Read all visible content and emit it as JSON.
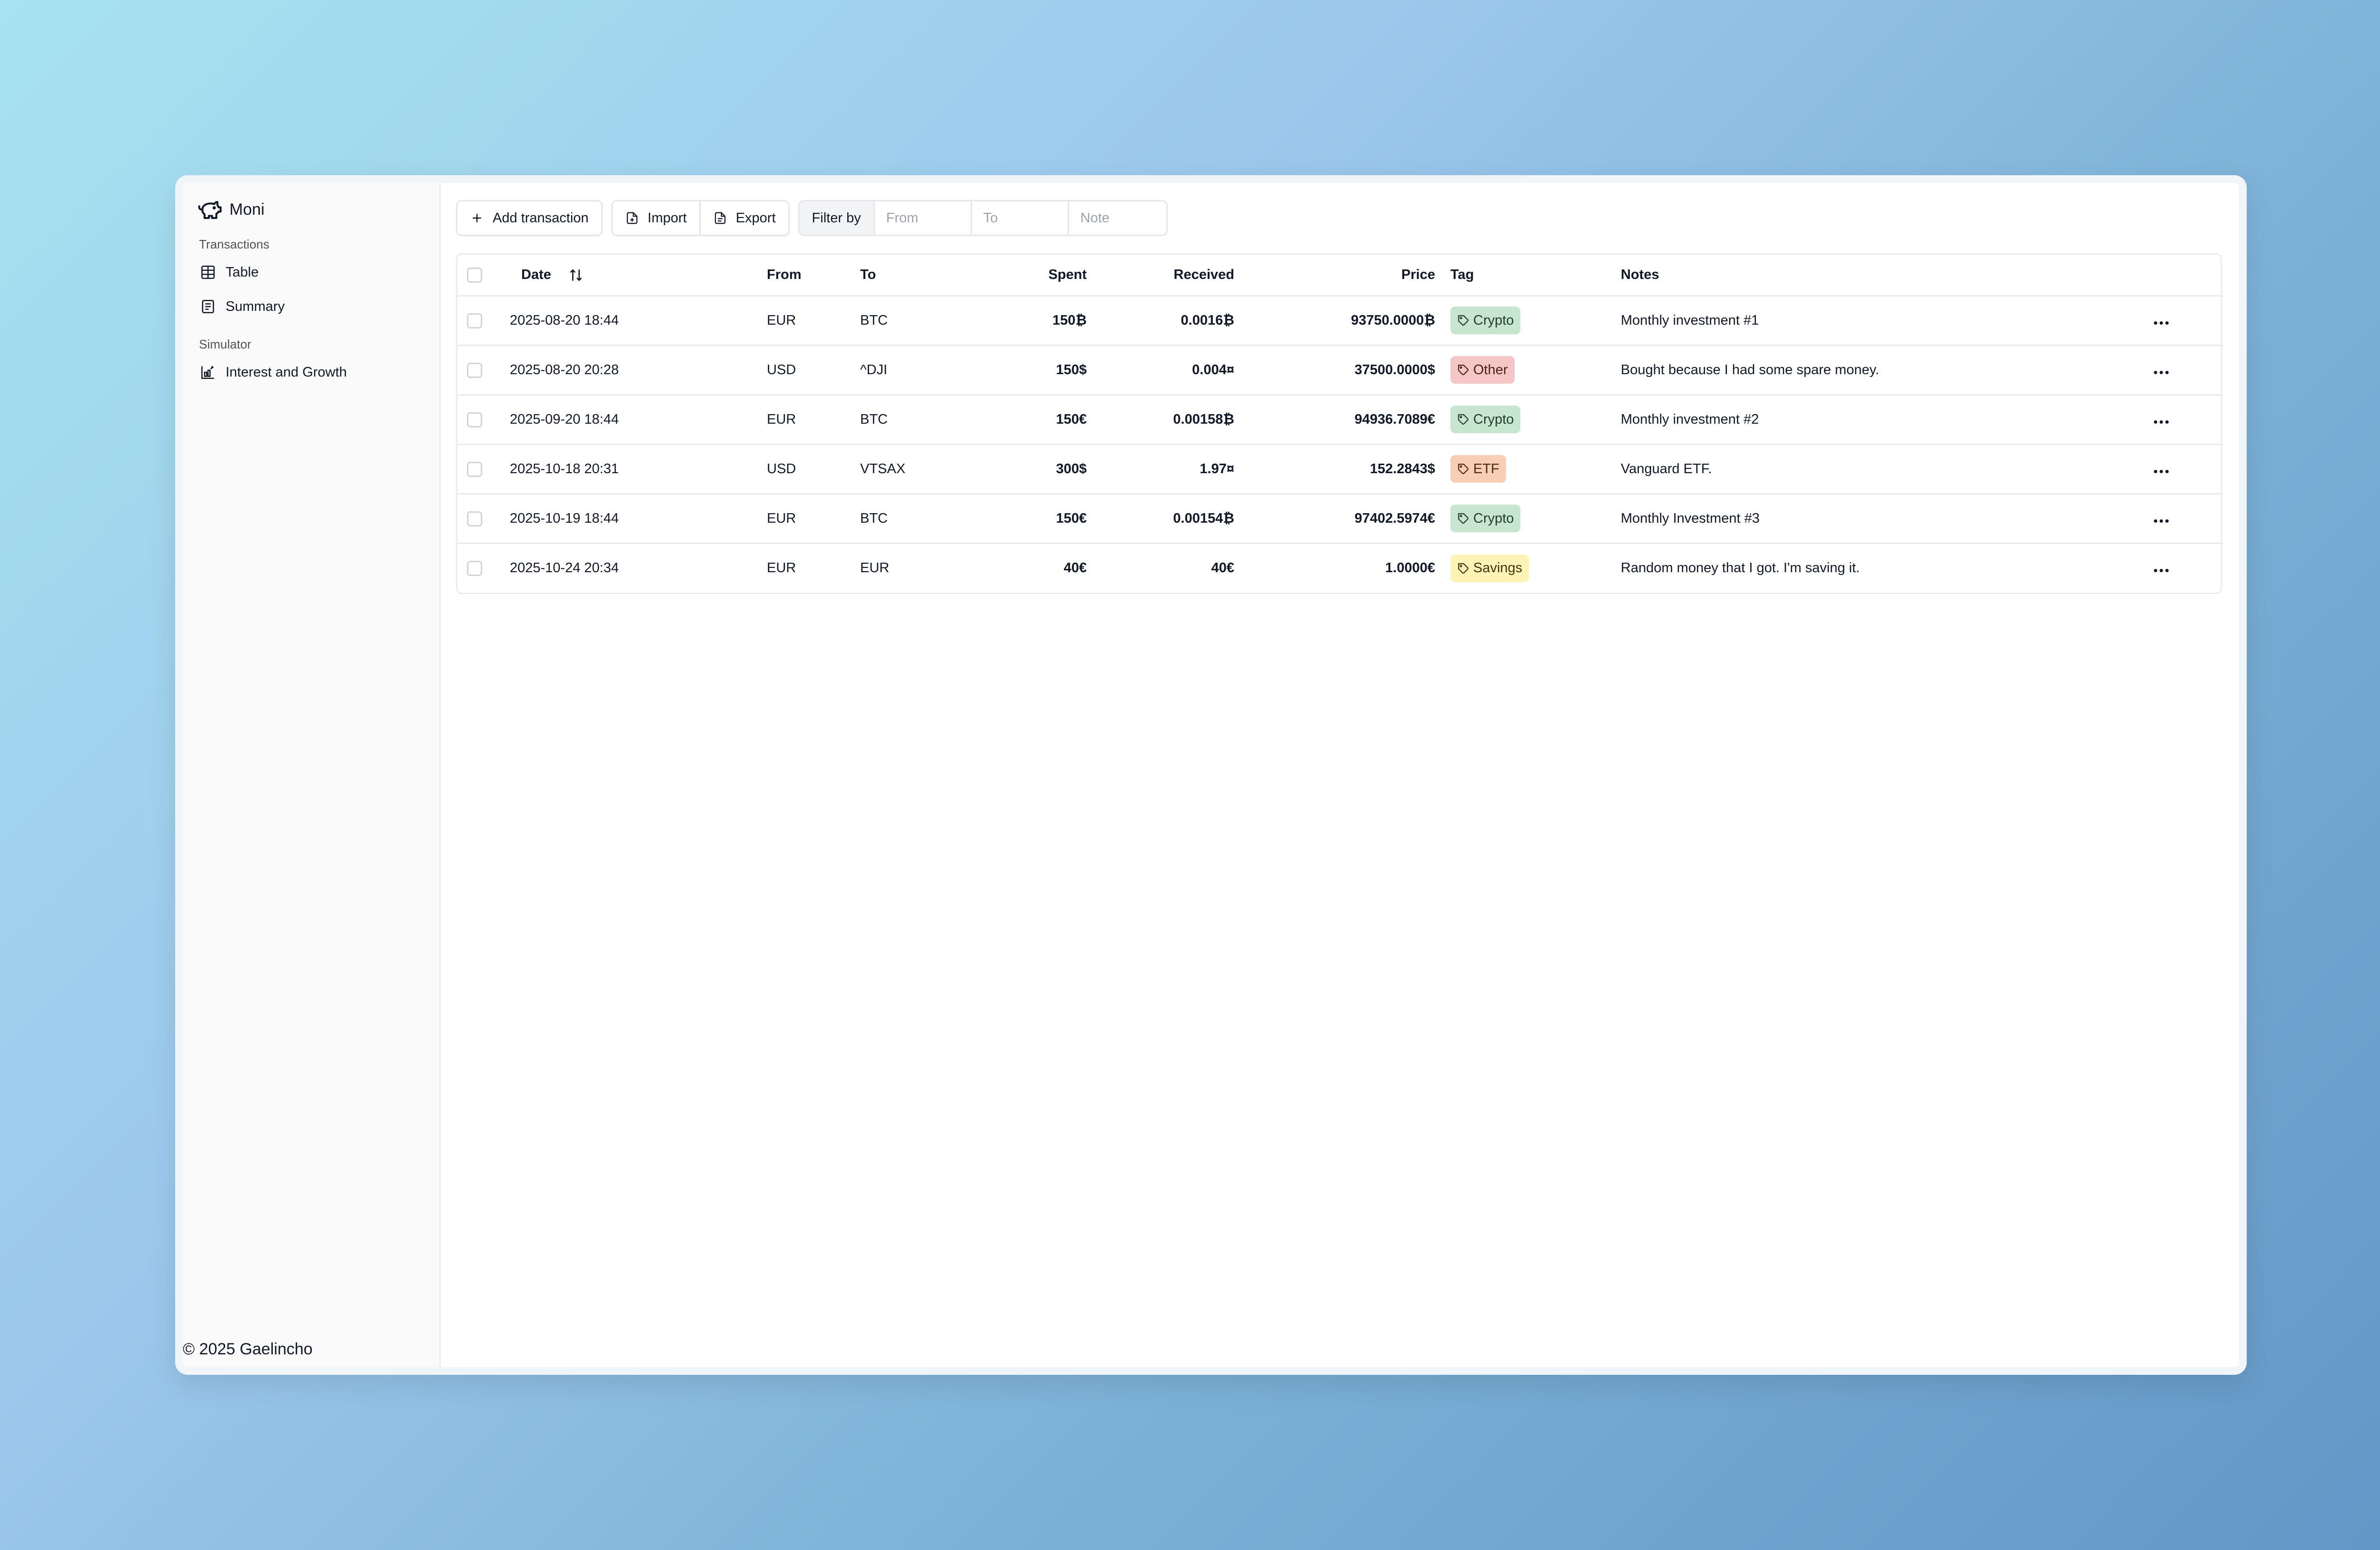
{
  "app": {
    "name": "Moni",
    "footer": "© 2025 Gaelincho"
  },
  "sidebar": {
    "sections": [
      {
        "label": "Transactions",
        "items": [
          {
            "label": "Table",
            "icon": "table-icon"
          },
          {
            "label": "Summary",
            "icon": "document-icon"
          }
        ]
      },
      {
        "label": "Simulator",
        "items": [
          {
            "label": "Interest and Growth",
            "icon": "chart-icon"
          }
        ]
      }
    ]
  },
  "toolbar": {
    "add_label": "Add transaction",
    "import_label": "Import",
    "export_label": "Export",
    "filter_label": "Filter by",
    "from_placeholder": "From",
    "to_placeholder": "To",
    "note_placeholder": "Note"
  },
  "table": {
    "columns": {
      "date": "Date",
      "from": "From",
      "to": "To",
      "spent": "Spent",
      "received": "Received",
      "price": "Price",
      "tag": "Tag",
      "notes": "Notes"
    },
    "rows": [
      {
        "date": "2025-08-20 18:44",
        "from": "EUR",
        "to": "BTC",
        "spent": "150₿",
        "received": "0.0016₿",
        "price": "93750.0000₿",
        "tag": "Crypto",
        "notes": "Monthly investment #1"
      },
      {
        "date": "2025-08-20 20:28",
        "from": "USD",
        "to": "^DJI",
        "spent": "150$",
        "received": "0.004¤",
        "price": "37500.0000$",
        "tag": "Other",
        "notes": "Bought because I had some spare money."
      },
      {
        "date": "2025-09-20 18:44",
        "from": "EUR",
        "to": "BTC",
        "spent": "150€",
        "received": "0.00158₿",
        "price": "94936.7089€",
        "tag": "Crypto",
        "notes": "Monthly investment #2"
      },
      {
        "date": "2025-10-18 20:31",
        "from": "USD",
        "to": "VTSAX",
        "spent": "300$",
        "received": "1.97¤",
        "price": "152.2843$",
        "tag": "ETF",
        "notes": "Vanguard ETF."
      },
      {
        "date": "2025-10-19 18:44",
        "from": "EUR",
        "to": "BTC",
        "spent": "150€",
        "received": "0.00154₿",
        "price": "97402.5974€",
        "tag": "Crypto",
        "notes": "Monthly Investment #3"
      },
      {
        "date": "2025-10-24 20:34",
        "from": "EUR",
        "to": "EUR",
        "spent": "40€",
        "received": "40€",
        "price": "1.0000€",
        "tag": "Savings",
        "notes": "Random money that I got. I'm saving it."
      }
    ]
  },
  "tag_colors": {
    "Crypto": {
      "bg": "#c6e6cf",
      "fg": "#1f3d2a"
    },
    "Other": {
      "bg": "#f5c6c6",
      "fg": "#4a1f1f"
    },
    "ETF": {
      "bg": "#f8cfb5",
      "fg": "#4a2a17"
    },
    "Savings": {
      "bg": "#fcf3b5",
      "fg": "#3f3510"
    }
  }
}
